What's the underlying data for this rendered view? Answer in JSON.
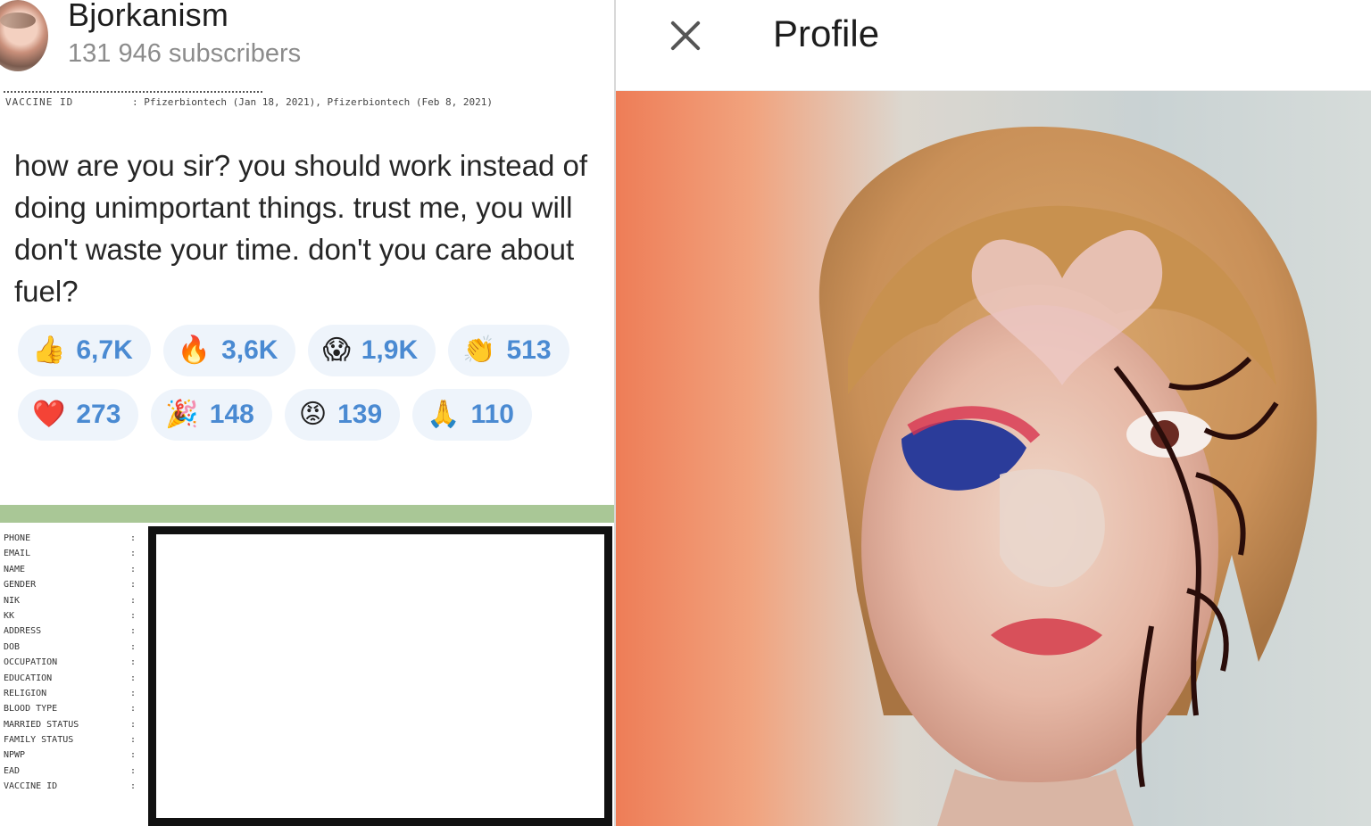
{
  "channel": {
    "name": "Bjorkanism",
    "subscribers": "131 946 subscribers"
  },
  "doc_top": {
    "label": "VACCINE ID",
    "value": ": Pfizerbiontech (Jan 18, 2021), Pfizerbiontech (Feb 8, 2021)"
  },
  "message": {
    "text": "how are you sir? you should work instead of\ndoing unimportant things. trust me, you will\ndon't waste your time. don't you care about\nfuel?"
  },
  "reactions": {
    "row1": [
      {
        "emoji": "👍",
        "count": "6,7K"
      },
      {
        "emoji": "🔥",
        "count": "3,6K"
      },
      {
        "emoji": "😱",
        "count": "1,9K"
      },
      {
        "emoji": "👏",
        "count": "513"
      }
    ],
    "row2": [
      {
        "emoji": "❤️",
        "count": "273"
      },
      {
        "emoji": "🎉",
        "count": "148"
      },
      {
        "emoji": "😡",
        "count": "139"
      },
      {
        "emoji": "🙏",
        "count": "110"
      }
    ]
  },
  "doc_fields": [
    "PHONE",
    "EMAIL",
    "NAME",
    "GENDER",
    "NIK",
    "KK",
    "ADDRESS",
    "DOB",
    "OCCUPATION",
    "EDUCATION",
    "RELIGION",
    "BLOOD TYPE",
    "MARRIED STATUS",
    "FAMILY STATUS",
    "NPWP",
    "EAD",
    "VACCINE ID"
  ],
  "doc_field_separator": ":",
  "profile": {
    "title": "Profile",
    "close_icon": "close-icon"
  },
  "colors": {
    "reaction_bg": "#eef4fb",
    "reaction_count": "#4a8ad2",
    "green_bar": "#a9c796",
    "redaction_border": "#111111"
  }
}
